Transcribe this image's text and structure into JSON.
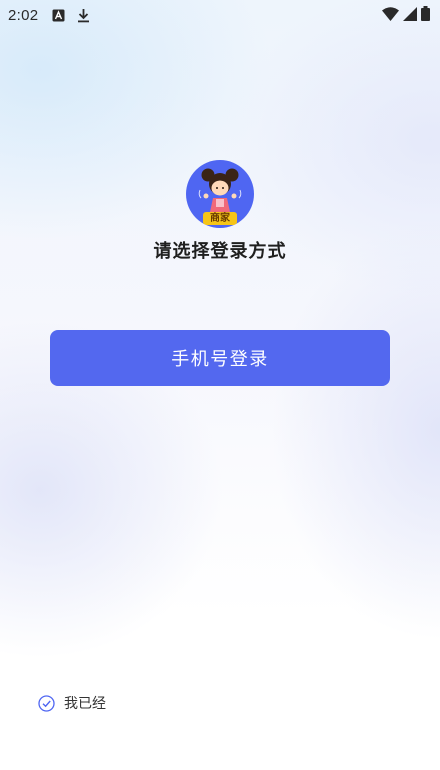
{
  "status_bar": {
    "time": "2:02",
    "left_icons": [
      "font-a-icon",
      "download-icon"
    ],
    "right_icons": [
      "wifi-icon",
      "signal-icon",
      "battery-icon"
    ]
  },
  "avatar": {
    "badge": "商家",
    "background": "#4f66f2"
  },
  "title": "请选择登录方式",
  "login_button": {
    "label": "手机号登录",
    "color": "#5368ef"
  },
  "agreement": {
    "text": "我已经",
    "checkbox_icon": "check-circle-icon",
    "accent": "#4f66f2"
  }
}
